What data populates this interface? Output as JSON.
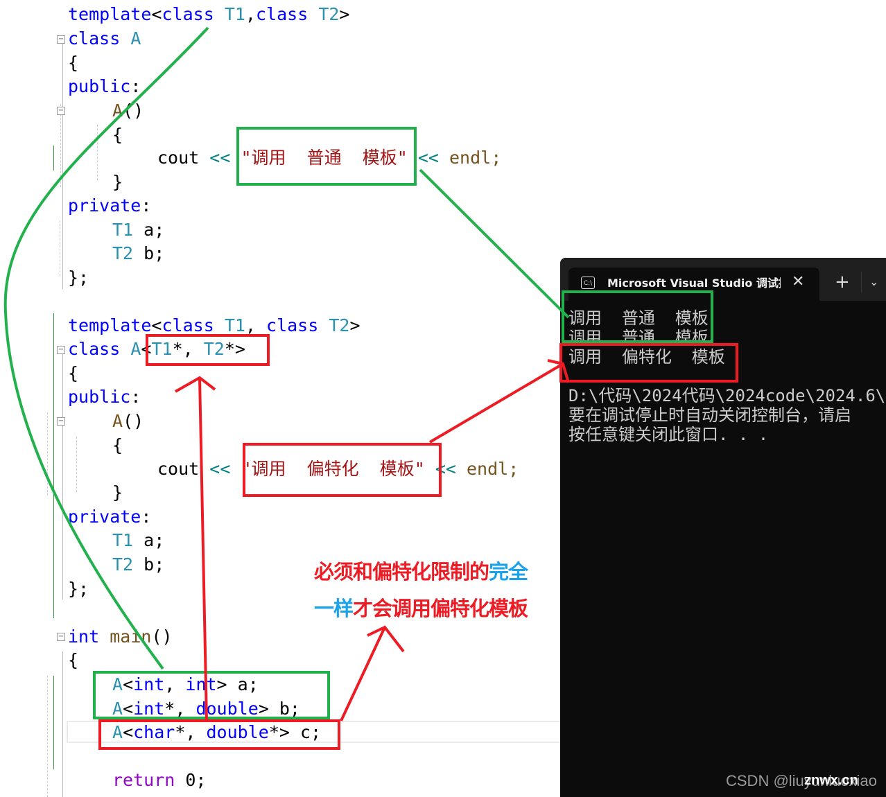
{
  "editor": {
    "block1": {
      "template_line": [
        "template",
        "<",
        "class",
        " ",
        "T1",
        ",",
        "class",
        " ",
        "T2",
        ">"
      ],
      "class_kw": "class",
      "class_name": "A",
      "open_brace": "{",
      "public": "public",
      "colon": ":",
      "ctor": "A",
      "ctor_parens": "()",
      "ctor_open": "{",
      "cout": "cout",
      "shift": "<<",
      "string": "\"调用  普通  模板\"",
      "endl": "endl;",
      "ctor_close": "}",
      "private": "private",
      "member_a_type": "T1",
      "member_a": " a;",
      "member_b_type": "T2",
      "member_b": " b;",
      "close": "};"
    },
    "block2": {
      "template_kw": "template",
      "lt": "<",
      "class1": "class",
      "t1": "T1",
      "comma": ", ",
      "class2": "class",
      "t2": "T2",
      "gt": ">",
      "class_kw": "class",
      "class_name": "A",
      "spec_lt": "<",
      "spec_t1": "T1",
      "spec_mid": "*, ",
      "spec_t2": "T2",
      "spec_end": "*>",
      "open_brace": "{",
      "public": "public",
      "colon": ":",
      "ctor": "A",
      "ctor_parens": "()",
      "ctor_open": "{",
      "cout": "cout",
      "shift": "<<",
      "string": "\"调用  偏特化  模板\"",
      "endl": "endl;",
      "ctor_close": "}",
      "private": "private",
      "member_a_type": "T1",
      "member_a": " a;",
      "member_b_type": "T2",
      "member_b": " b;",
      "close": "};"
    },
    "main": {
      "int_kw": "int",
      "main_fn": "main",
      "parens": "()",
      "open_brace": "{",
      "decls": [
        {
          "type": "A",
          "args_pre": "<",
          "arg1": "int",
          "mid": ", ",
          "arg2": "int",
          "post": "> a;"
        },
        {
          "type": "A",
          "args_pre": "<",
          "arg1": "int",
          "mid": "*, ",
          "arg2": "double",
          "post": "> b;"
        },
        {
          "type": "A",
          "args_pre": "<",
          "arg1": "char",
          "mid": "*, ",
          "arg2": "double",
          "post": "*> c;"
        }
      ],
      "return_kw": "return",
      "return_val": " 0;"
    }
  },
  "annotation": {
    "line1_red": "必须和偏特化限制的",
    "line1_blue": "完全",
    "line2_blue": "一样",
    "line2_red": "才会调用偏特化模板"
  },
  "console": {
    "tab_icon": "C:\\",
    "tab_title": "Microsoft Visual Studio 调试控制台",
    "close_icon": "✕",
    "new_tab_icon": "+",
    "dropdown_icon": "⌄",
    "output_lines": [
      "调用  普通  模板",
      "调用  普通  模板",
      "调用  偏特化  模板",
      "",
      "D:\\代码\\2024代码\\2024code\\2024.6\\",
      "要在调试停止时自动关闭控制台，请启",
      "按任意键关闭此窗口. . ."
    ]
  },
  "watermark": {
    "csdn": "CSDN @liuyunluoxiao",
    "site": "znwx.cn"
  },
  "colors": {
    "keyword": "#0000ff",
    "type": "#2b91af",
    "string": "#a31515",
    "annotation_green": "#22b14c",
    "annotation_red": "#ed1c24",
    "annotation_blue": "#1aa3e8",
    "console_bg": "#0c0c0c"
  }
}
